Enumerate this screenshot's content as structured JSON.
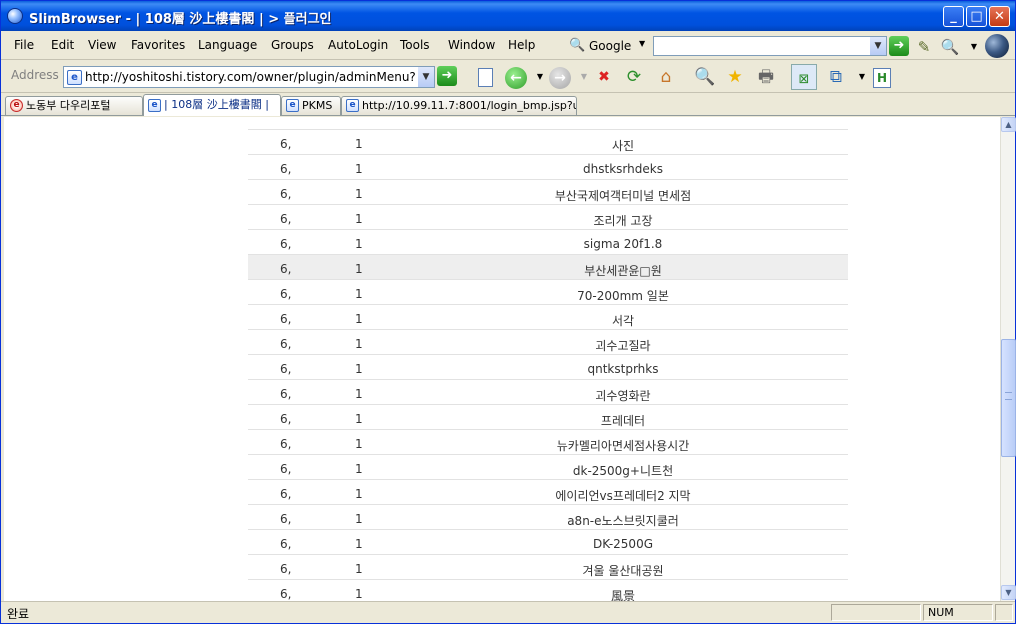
{
  "window": {
    "title": "SlimBrowser - | 108層 沙上樓書閣 | > 플러그인",
    "minimize_label": "_",
    "maximize_label": "□",
    "close_label": "✕"
  },
  "menu": {
    "items": [
      "File",
      "Edit",
      "View",
      "Favorites",
      "Language",
      "Groups",
      "AutoLogin",
      "Tools",
      "Window",
      "Help"
    ]
  },
  "search": {
    "engine": "Google",
    "value": ""
  },
  "address": {
    "label": "Address",
    "url": "http://yoshitoshi.tistory.com/owner/plugin/adminMenu?na"
  },
  "tabs": [
    {
      "label": "노동부 다우리포털",
      "active": false
    },
    {
      "label": "| 108層 沙上樓書閣 |",
      "active": true
    },
    {
      "label": "PKMS",
      "active": false
    },
    {
      "label": "http://10.99.11.7:8001/login_bmp.jsp?u...",
      "active": false
    }
  ],
  "table": {
    "rows": [
      {
        "a": "6,",
        "b": "1",
        "c": "사진"
      },
      {
        "a": "6,",
        "b": "1",
        "c": "dhstksrhdeks"
      },
      {
        "a": "6,",
        "b": "1",
        "c": "부산국제여객터미널 면세점"
      },
      {
        "a": "6,",
        "b": "1",
        "c": "조리개 고장"
      },
      {
        "a": "6,",
        "b": "1",
        "c": "sigma 20f1.8"
      },
      {
        "a": "6,",
        "b": "1",
        "c": "부산세관윤□원",
        "highlight": true
      },
      {
        "a": "6,",
        "b": "1",
        "c": "70-200mm 일본"
      },
      {
        "a": "6,",
        "b": "1",
        "c": "서각"
      },
      {
        "a": "6,",
        "b": "1",
        "c": "괴수고질라"
      },
      {
        "a": "6,",
        "b": "1",
        "c": "qntkstprhks"
      },
      {
        "a": "6,",
        "b": "1",
        "c": "괴수영화란"
      },
      {
        "a": "6,",
        "b": "1",
        "c": "프레데터"
      },
      {
        "a": "6,",
        "b": "1",
        "c": "뉴카멜리아면세점사용시간"
      },
      {
        "a": "6,",
        "b": "1",
        "c": "dk-2500g+니트천"
      },
      {
        "a": "6,",
        "b": "1",
        "c": "에이리언vs프레데터2 지막"
      },
      {
        "a": "6,",
        "b": "1",
        "c": "a8n-e노스브릿지쿨러"
      },
      {
        "a": "6,",
        "b": "1",
        "c": "DK-2500G"
      },
      {
        "a": "6,",
        "b": "1",
        "c": "겨울 울산대공원"
      },
      {
        "a": "6,",
        "b": "1",
        "c": "風景"
      }
    ]
  },
  "status": {
    "text": "완료",
    "num": "NUM"
  }
}
